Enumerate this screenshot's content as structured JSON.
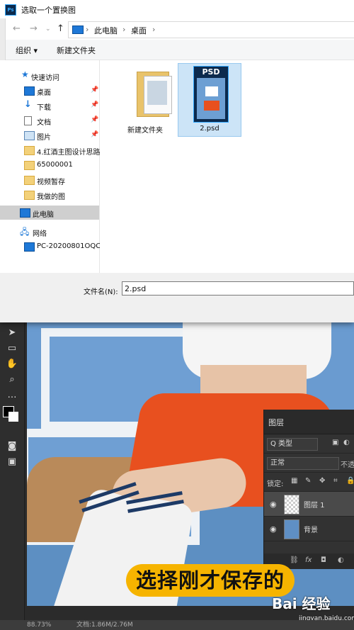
{
  "dialog": {
    "title": "选取一个置换图",
    "address": {
      "root": "此电脑",
      "current": "桌面",
      "sep": "›"
    },
    "commands": {
      "organize": "组织 ▾",
      "new_folder": "新建文件夹"
    },
    "nav_items": [
      {
        "label": "快速访问",
        "icon": "star-icon",
        "pinned": false
      },
      {
        "label": "桌面",
        "icon": "desktop-icon",
        "pinned": true
      },
      {
        "label": "下载",
        "icon": "download-icon",
        "pinned": true
      },
      {
        "label": "文档",
        "icon": "document-icon",
        "pinned": true
      },
      {
        "label": "图片",
        "icon": "picture-icon",
        "pinned": true
      },
      {
        "label": "4.红酒主图设计思路",
        "icon": "folder-icon",
        "pinned": false
      },
      {
        "label": "65000001",
        "icon": "folder-icon",
        "pinned": false
      },
      {
        "label": "视频暂存",
        "icon": "folder-icon",
        "pinned": false
      },
      {
        "label": "我做的图",
        "icon": "folder-icon",
        "pinned": false
      },
      {
        "label": "此电脑",
        "icon": "computer-icon",
        "pinned": false,
        "selected": true
      },
      {
        "label": "网络",
        "icon": "network-icon",
        "pinned": false
      },
      {
        "label": "PC-20200801OQC",
        "icon": "pc-icon",
        "pinned": false
      }
    ],
    "files": [
      {
        "name": "新建文件夹",
        "type": "folder"
      },
      {
        "name": "2.psd",
        "type": "psd",
        "badge": "PSD",
        "selected": true
      }
    ],
    "filename_label": "文件名(N):",
    "filename_value": "2.psd"
  },
  "ps": {
    "layers_panel": {
      "tab": "图层",
      "filter": "Q 类型",
      "blend_mode": "正常",
      "opacity_label": "不透",
      "lock_label": "锁定:",
      "layers": [
        {
          "name": "图层 1",
          "selected": true
        },
        {
          "name": "背景",
          "selected": false
        }
      ],
      "footer": "fx"
    },
    "status": {
      "zoom": "88.73%",
      "doc": "文档:1.86M/2.76M"
    },
    "caption": "选择刚才保存的",
    "watermark": {
      "logo": "Bai 经验",
      "sub": "jingyan.baidu.com"
    }
  },
  "colors": {
    "ps_accent": "#31a8ff",
    "caption_bg": "#f6b400",
    "selection": "#cce4f7"
  }
}
